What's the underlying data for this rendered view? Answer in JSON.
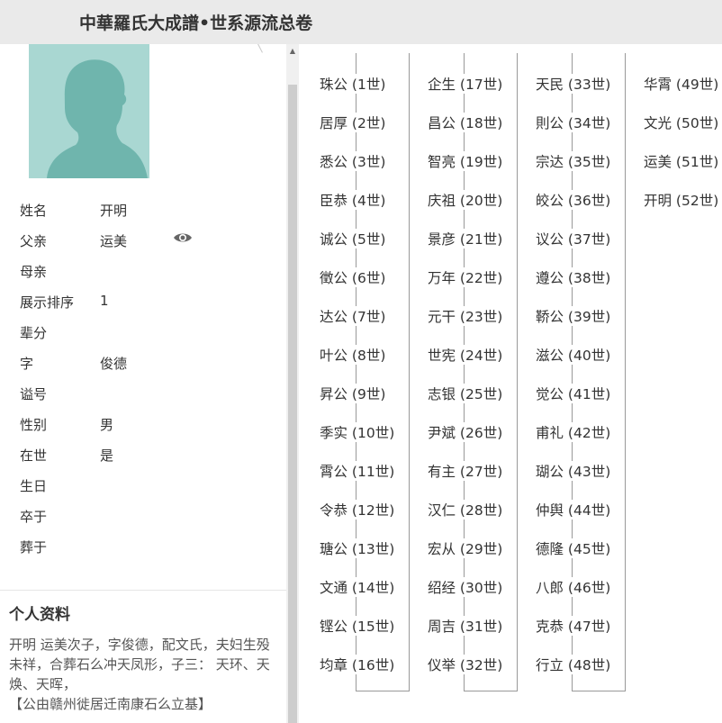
{
  "header": {
    "title": "中華羅氏大成譜•世系源流总卷"
  },
  "profile": {
    "fields": [
      {
        "label": "姓名",
        "value": "开明"
      },
      {
        "label": "父亲",
        "value": "运美"
      },
      {
        "label": "母亲",
        "value": ""
      },
      {
        "label": "展示排序",
        "value": "1"
      },
      {
        "label": "辈分",
        "value": ""
      },
      {
        "label": "字",
        "value": "俊德"
      },
      {
        "label": "谥号",
        "value": ""
      },
      {
        "label": "性别",
        "value": "男"
      },
      {
        "label": "在世",
        "value": "是"
      },
      {
        "label": "生日",
        "value": ""
      },
      {
        "label": "卒于",
        "value": ""
      },
      {
        "label": "葬于",
        "value": ""
      }
    ],
    "father_view_icon": "eye-icon",
    "avatar_icon": "person-silhouette-icon",
    "avatar_bg": "#a9d7d2",
    "avatar_fg": "#6fb5ad"
  },
  "bio": {
    "title": "个人资料",
    "text": "开明  运美次子，字俊德，配文氏，夫妇生殁未祥，合葬石么冲天凤形，子三：  天环、天焕、天晖，\n【公由赣州徙居迁南康石么立基】"
  },
  "lineage": {
    "columns": [
      [
        "珠公 (1世)",
        "居厚 (2世)",
        "悉公 (3世)",
        "臣恭 (4世)",
        "诚公 (5世)",
        "徵公 (6世)",
        "达公 (7世)",
        "叶公 (8世)",
        "昇公 (9世)",
        "季实 (10世)",
        "霄公 (11世)",
        "令恭 (12世)",
        "瑭公 (13世)",
        "文通 (14世)",
        "铿公 (15世)",
        "均章 (16世)"
      ],
      [
        "企生 (17世)",
        "昌公 (18世)",
        "智亮 (19世)",
        "庆祖 (20世)",
        "景彦 (21世)",
        "万年 (22世)",
        "元干 (23世)",
        "世宪 (24世)",
        "志银 (25世)",
        "尹斌 (26世)",
        "有主 (27世)",
        "汉仁 (28世)",
        "宏从 (29世)",
        "绍经 (30世)",
        "周吉 (31世)",
        "仪举 (32世)"
      ],
      [
        "天民 (33世)",
        "則公 (34世)",
        "宗达 (35世)",
        "皎公 (36世)",
        "议公 (37世)",
        "遵公 (38世)",
        "鞒公 (39世)",
        "滋公 (40世)",
        "觉公 (41世)",
        "甫礼 (42世)",
        "瑚公 (43世)",
        "仲舆 (44世)",
        "德隆 (45世)",
        "八郎 (46世)",
        "克恭 (47世)",
        "行立 (48世)"
      ],
      [
        "华霄 (49世)",
        "文光 (50世)",
        "运美 (51世)",
        "开明 (52世)"
      ]
    ]
  }
}
